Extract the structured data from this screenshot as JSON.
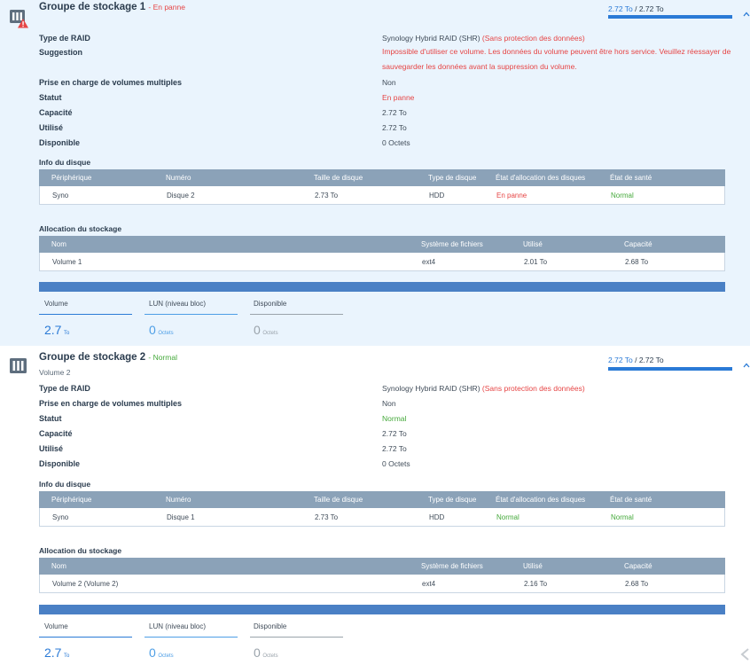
{
  "pool1": {
    "title": "Groupe de stockage 1",
    "status": "En panne",
    "usage_used": "2.72 To",
    "usage_sep": " / ",
    "usage_total": "2.72 To",
    "props": {
      "raid_label": "Type de RAID",
      "raid_value": "Synology Hybrid RAID (SHR)",
      "raid_note": "(Sans protection des données)",
      "suggestion_label": "Suggestion",
      "suggestion_value": "Impossible d'utiliser ce volume. Les données du volume peuvent être hors service. Veuillez réessayer de sauvegarder les données avant la suppression du volume.",
      "multi_label": "Prise en charge de volumes multiples",
      "multi_value": "Non",
      "statut_label": "Statut",
      "statut_value": "En panne",
      "capacite_label": "Capacité",
      "capacite_value": "2.72 To",
      "utilise_label": "Utilisé",
      "utilise_value": "2.72 To",
      "disponible_label": "Disponible",
      "disponible_value": "0 Octets"
    },
    "disk_section_title": "Info du disque",
    "disk_headers": [
      "Périphérique",
      "Numéro",
      "Taille de disque",
      "Type de disque",
      "État d'allocation des disques",
      "État de santé"
    ],
    "disk_row": [
      "Syno",
      "Disque 2",
      "2.73 To",
      "HDD",
      "En panne",
      "Normal"
    ],
    "alloc_section_title": "Allocation du stockage",
    "alloc_headers": [
      "Nom",
      "Système de fichiers",
      "Utilisé",
      "Capacité"
    ],
    "alloc_row": [
      "Volume 1",
      "ext4",
      "2.01 To",
      "2.68 To"
    ],
    "tabs": {
      "volume_label": "Volume",
      "lun_label": "LUN (niveau bloc)",
      "dispo_label": "Disponible",
      "volume_num": "2.7",
      "volume_unit": "To",
      "lun_num": "0",
      "lun_unit": "Octets",
      "dispo_num": "0",
      "dispo_unit": "Octets"
    }
  },
  "pool2": {
    "title": "Groupe de stockage 2",
    "status": "Normal",
    "subtitle": "Volume 2",
    "usage_used": "2.72 To",
    "usage_sep": " / ",
    "usage_total": "2.72 To",
    "props": {
      "raid_label": "Type de RAID",
      "raid_value": "Synology Hybrid RAID (SHR)",
      "raid_note": "(Sans protection des données)",
      "multi_label": "Prise en charge de volumes multiples",
      "multi_value": "Non",
      "statut_label": "Statut",
      "statut_value": "Normal",
      "capacite_label": "Capacité",
      "capacite_value": "2.72 To",
      "utilise_label": "Utilisé",
      "utilise_value": "2.72 To",
      "disponible_label": "Disponible",
      "disponible_value": "0 Octets"
    },
    "disk_section_title": "Info du disque",
    "disk_headers": [
      "Périphérique",
      "Numéro",
      "Taille de disque",
      "Type de disque",
      "État d'allocation des disques",
      "État de santé"
    ],
    "disk_row": [
      "Syno",
      "Disque 1",
      "2.73 To",
      "HDD",
      "Normal",
      "Normal"
    ],
    "alloc_section_title": "Allocation du stockage",
    "alloc_headers": [
      "Nom",
      "Système de fichiers",
      "Utilisé",
      "Capacité"
    ],
    "alloc_row": [
      "Volume 2 (Volume 2)",
      "ext4",
      "2.16 To",
      "2.68 To"
    ],
    "tabs": {
      "volume_label": "Volume",
      "lun_label": "LUN (niveau bloc)",
      "dispo_label": "Disponible",
      "volume_num": "2.7",
      "volume_unit": "To",
      "lun_num": "0",
      "lun_unit": "Octets",
      "dispo_num": "0",
      "dispo_unit": "Octets"
    }
  },
  "colors": {
    "accent": "#2a7ad6",
    "error": "#e64545",
    "ok": "#45a93b",
    "table_header": "#8ba2b8",
    "alloc_bar": "#4a80c5",
    "selected_bg": "#eaf4fd"
  },
  "icons": {
    "pool1": "storage-pool-warning-icon",
    "pool2": "storage-pool-icon",
    "collapse": "chevron-up-icon",
    "corner": "chevron-left-icon"
  }
}
